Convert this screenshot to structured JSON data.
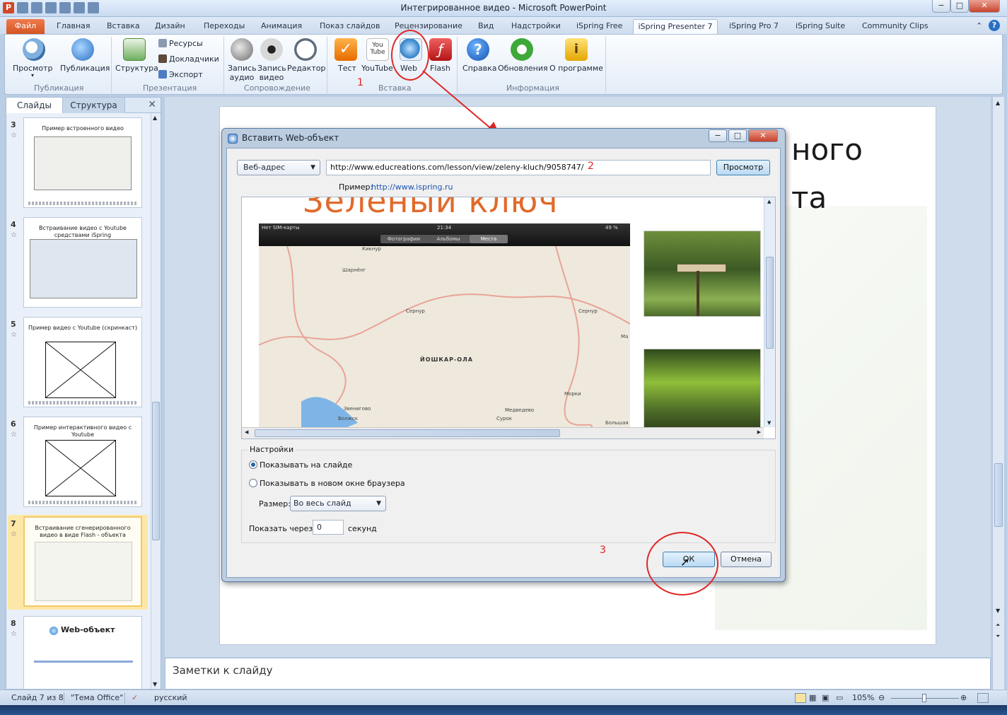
{
  "window": {
    "title": "Интегрированное видео - Microsoft PowerPoint",
    "min": "−",
    "max": "□",
    "close": "✕",
    "app_letter": "P"
  },
  "ribbon_tabs": [
    {
      "label": "Файл"
    },
    {
      "label": "Главная"
    },
    {
      "label": "Вставка"
    },
    {
      "label": "Дизайн"
    },
    {
      "label": "Переходы"
    },
    {
      "label": "Анимация"
    },
    {
      "label": "Показ слайдов"
    },
    {
      "label": "Рецензирование"
    },
    {
      "label": "Вид"
    },
    {
      "label": "Надстройки"
    },
    {
      "label": "iSpring Free"
    },
    {
      "label": "iSpring Presenter 7"
    },
    {
      "label": "iSpring Pro 7"
    },
    {
      "label": "iSpring Suite"
    },
    {
      "label": "Community Clips"
    }
  ],
  "ribbon": {
    "preview": "Просмотр",
    "publish": "Публикация",
    "structure": "Структура",
    "resources": "Ресурсы",
    "speakers": "Докладчики",
    "export": "Экспорт",
    "record_audio": "Запись аудио",
    "record_video": "Запись видео",
    "editor": "Редактор",
    "test": "Тест",
    "youtube": "YouTube",
    "youtube_icon_text": "You Tube",
    "web": "Web",
    "flash": "Flash",
    "help": "Справка",
    "updates": "Обновления",
    "about": "О программе",
    "groups": {
      "publication": "Публикация",
      "presentation": "Презентация",
      "accompaniment": "Сопровождение",
      "insert": "Вставка",
      "info": "Информация"
    }
  },
  "annotations": {
    "one": "1",
    "two": "2",
    "three": "3"
  },
  "slides_panel": {
    "tab_slides": "Слайды",
    "tab_outline": "Структура",
    "close": "✕",
    "thumbs": [
      {
        "num": "3",
        "title": "Пример встроенного видео"
      },
      {
        "num": "4",
        "title": "Встраивание видео с Youtube средствами iSpring"
      },
      {
        "num": "5",
        "title": "Пример видео с Youtube (скринкаст)"
      },
      {
        "num": "6",
        "title": "Пример интерактивного видео с Youtube"
      },
      {
        "num": "7",
        "title": "Встраивание сгенерированного видео в виде Flash - объекта"
      },
      {
        "num": "8",
        "title": "Web-объект"
      }
    ]
  },
  "slide": {
    "title_line1": "ного",
    "title_line2": "та"
  },
  "notes": {
    "placeholder": "Заметки к слайду"
  },
  "dialog": {
    "title": "Вставить Web-объект",
    "source_type": "Веб-адрес",
    "url": "http://www.educreations.com/lesson/view/zeleny-kluch/9058747/",
    "preview_button": "Просмотр",
    "example_label": "Пример:",
    "example_url": "http://www.ispring.ru",
    "preview_title": "Зеленый ключ",
    "map": {
      "carrier": "Нет SIM-карты",
      "time": "21:34",
      "battery": "49 %",
      "tab_photos": "Фотографии",
      "tab_albums": "Альбомы",
      "tab_places": "Места",
      "city": "ЙОШКАР-ОЛА",
      "places": [
        "Кикнур",
        "Шарнёнг",
        "Сернур",
        "Сернур",
        "Звенигово",
        "Морки",
        "Медведево",
        "Сурок",
        "Большая",
        "Ма",
        "Волжск"
      ]
    },
    "settings_title": "Настройки",
    "show_on_slide": "Показывать на слайде",
    "show_in_browser": "Показывать в новом окне браузера",
    "size_label": "Размер:",
    "size_value": "Во весь слайд",
    "delay_label": "Показать через:",
    "delay_value": "0",
    "delay_unit": "секунд",
    "ok": "ОК",
    "cancel": "Отмена"
  },
  "statusbar": {
    "slide_info": "Слайд 7 из 8",
    "theme": "\"Тема Office\"",
    "language": "русский",
    "zoom": "105%"
  },
  "colors": {
    "annotation_red": "#e02828",
    "file_tab": "#d45423",
    "accent_blue": "#2661a7"
  }
}
